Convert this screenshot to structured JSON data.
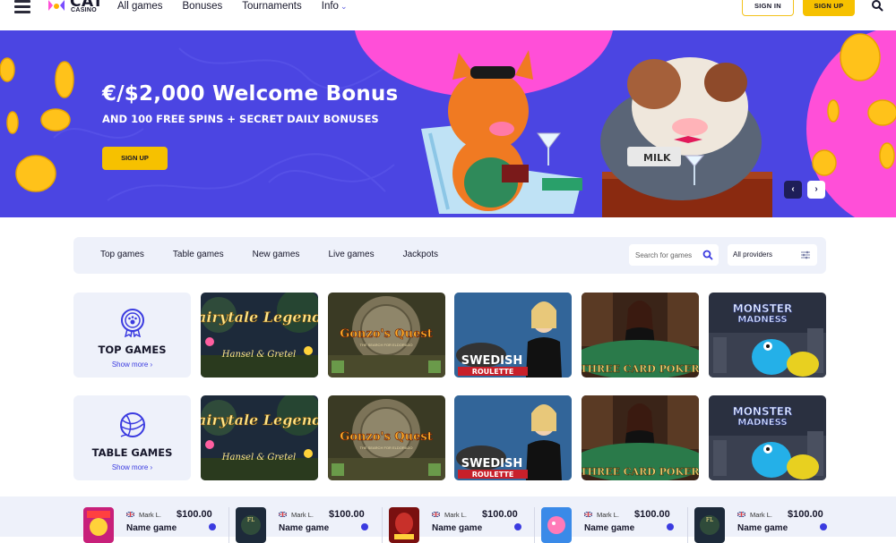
{
  "header": {
    "logo_word": "CAT",
    "logo_sub": "CASINO",
    "nav": [
      {
        "label": "All games"
      },
      {
        "label": "Bonuses"
      },
      {
        "label": "Tournaments"
      },
      {
        "label": "Info"
      }
    ],
    "signin_label": "SIGN IN",
    "signup_label": "SIGN UP"
  },
  "hero": {
    "title": "€/$2,000 Welcome Bonus",
    "subtitle": "AND 100 FREE SPINS + SECRET DAILY BONUSES",
    "button_label": "SIGN UP",
    "prev": "‹",
    "next": "›",
    "sign_text": "MILK"
  },
  "filters": {
    "tabs": [
      "Top games",
      "Table games",
      "New games",
      "Live games",
      "Jackpots"
    ],
    "search_placeholder": "Search for games",
    "providers_value": "All providers"
  },
  "rows": [
    {
      "category": "TOP GAMES",
      "show_more": "Show more ›",
      "icon": "medal-paw-icon",
      "games": [
        {
          "title": "Fairytale Legends",
          "sub": "Hansel & Gretel"
        },
        {
          "title": "Gonzo's Quest",
          "sub": "THE SEARCH FOR ELDORADO"
        },
        {
          "title": "SWEDISH",
          "sub": "ROULETTE"
        },
        {
          "title": "THREE CARD POKER",
          "sub": ""
        },
        {
          "title": "MONSTER",
          "sub": "MADNESS"
        }
      ]
    },
    {
      "category": "TABLE GAMES",
      "show_more": "Show more ›",
      "icon": "yarn-ball-icon",
      "games": [
        {
          "title": "Fairytale Legends",
          "sub": "Hansel & Gretel"
        },
        {
          "title": "Gonzo's Quest",
          "sub": "THE SEARCH FOR ELDORADO"
        },
        {
          "title": "SWEDISH",
          "sub": "ROULETTE"
        },
        {
          "title": "THREE CARD POKER",
          "sub": ""
        },
        {
          "title": "MONSTER",
          "sub": "MADNESS"
        }
      ]
    }
  ],
  "winners": [
    {
      "user": "Mark L.",
      "amount": "$100.00",
      "game": "Name game"
    },
    {
      "user": "Mark L.",
      "amount": "$100.00",
      "game": "Name game"
    },
    {
      "user": "Mark L.",
      "amount": "$100.00",
      "game": "Name game"
    },
    {
      "user": "Mark L.",
      "amount": "$100.00",
      "game": "Name game"
    },
    {
      "user": "Mark L.",
      "amount": "$100.00",
      "game": "Name game"
    }
  ],
  "colors": {
    "accent_yellow": "#f6c100",
    "hero_blue": "#4b45e2",
    "hero_pink": "#ff4fd8",
    "link_blue": "#3b3be0",
    "panel_bg": "#eef1fa",
    "text_dark": "#17172b"
  }
}
